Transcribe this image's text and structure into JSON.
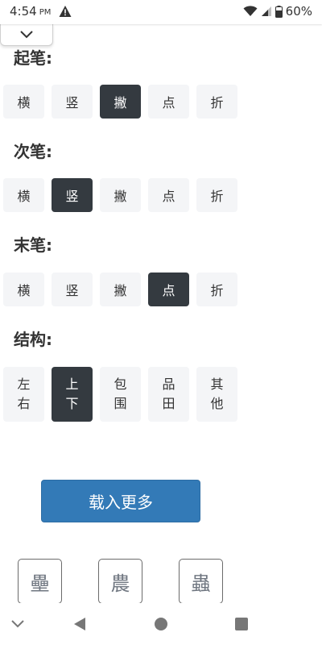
{
  "status_bar": {
    "time": "4:54",
    "ampm": "PM",
    "battery": "60%",
    "icons": [
      "warning-icon",
      "wifi-icon",
      "signal-icon",
      "battery-icon"
    ]
  },
  "collapse": {
    "icon": "chevron-down-icon"
  },
  "sections": {
    "start": {
      "label": "起笔:",
      "options": [
        "横",
        "竖",
        "撇",
        "点",
        "折"
      ],
      "selected": "撇"
    },
    "next": {
      "label": "次笔:",
      "options": [
        "横",
        "竖",
        "撇",
        "点",
        "折"
      ],
      "selected": "竖"
    },
    "end": {
      "label": "末笔:",
      "options": [
        "横",
        "竖",
        "撇",
        "点",
        "折"
      ],
      "selected": "点"
    },
    "structure": {
      "label": "结构:",
      "options": [
        {
          "line1": "左",
          "line2": "右"
        },
        {
          "line1": "上",
          "line2": "下"
        },
        {
          "line1": "包",
          "line2": "围"
        },
        {
          "line1": "品",
          "line2": "田"
        },
        {
          "line1": "其",
          "line2": "他"
        }
      ],
      "selected": "上下"
    }
  },
  "load_more_label": "载入更多",
  "results": [
    "壘",
    "農",
    "蟲"
  ],
  "colors": {
    "active_bg": "#343a40",
    "option_bg": "#f4f5f7",
    "primary": "#337ab7"
  }
}
